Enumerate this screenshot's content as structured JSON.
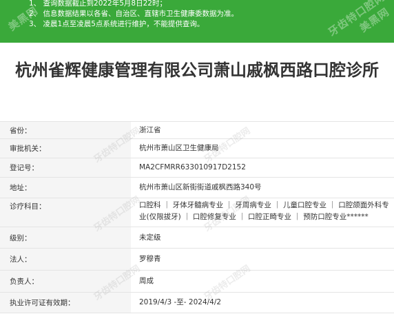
{
  "notice": {
    "lines": [
      "1、 查询数据截止到2022年5月8日22时；",
      "2、 信息数据结果以各省、自治区、直辖市卫生健康委数据为准。",
      "3、 凌晨1点至凌晨5点系统进行维护，不能提供查询。"
    ],
    "colors": {
      "background": "#3aa93a",
      "text": "#ffffff"
    }
  },
  "watermark": {
    "brand": "美黑网",
    "site": "牙齿特口腔网"
  },
  "clinic": {
    "name": "杭州雀辉健康管理有限公司萧山戚枫西路口腔诊所"
  },
  "details": [
    {
      "label": "省份：",
      "value": "浙江省"
    },
    {
      "label": "审批机关：",
      "value": "杭州市萧山区卫生健康局"
    },
    {
      "label": "登记号：",
      "value": "MA2CFMRR633010917D2152"
    },
    {
      "label": "地址：",
      "value": "杭州市萧山区新街街道戚枫西路340号"
    },
    {
      "label": "诊疗科目：",
      "value": "口腔科 ｜ 牙体牙髓病专业 ｜ 牙周病专业 ｜ 儿童口腔专业 ｜ 口腔颌面外科专业(仅限拔牙) ｜ 口腔修复专业 ｜ 口腔正畸专业 ｜ 预防口腔专业******"
    },
    {
      "label": "级别：",
      "value": "未定级"
    },
    {
      "label": "法人：",
      "value": "罗穆青"
    },
    {
      "label": "负责人：",
      "value": "周成"
    },
    {
      "label": "执业许可证有效期：",
      "value": "2019/4/3 -至- 2024/4/2"
    }
  ]
}
